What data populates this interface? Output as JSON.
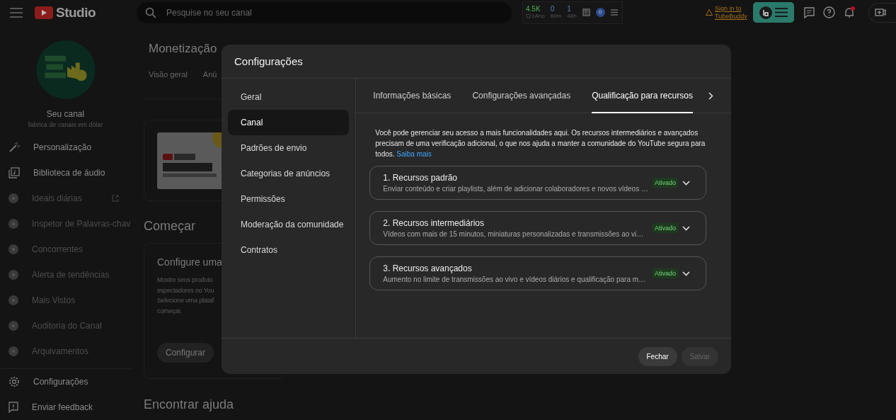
{
  "header": {
    "logo_text": "Studio",
    "search": {
      "placeholder": "Pesquise no seu canal"
    },
    "stats": [
      {
        "value": "4.5K",
        "label": "1Ano"
      },
      {
        "value": "0",
        "label": "60m"
      },
      {
        "value": "1",
        "label": "48h"
      }
    ],
    "signin_link": "Sign in to TubeBuddy"
  },
  "sidebar": {
    "channel_name": "Seu canal",
    "channel_handle": "fabrica de canais em dólar",
    "items": [
      {
        "label": "Personalização",
        "kind": "main",
        "external": false
      },
      {
        "label": "Biblioteca de áudio",
        "kind": "main",
        "external": false
      },
      {
        "label": "Ideais diárias",
        "kind": "addon",
        "external": true
      },
      {
        "label": "Inspetor de Palavras-chav",
        "kind": "addon",
        "external": false
      },
      {
        "label": "Concorrentes",
        "kind": "addon",
        "external": false
      },
      {
        "label": "Alerta de tendências",
        "kind": "addon",
        "external": false
      },
      {
        "label": "Mais Vistos",
        "kind": "addon",
        "external": false
      },
      {
        "label": "Auditoria do Canal",
        "kind": "addon",
        "external": false
      },
      {
        "label": "Arquivamentos",
        "kind": "addon",
        "external": false
      }
    ],
    "footer_items": [
      {
        "label": "Configurações"
      },
      {
        "label": "Enviar feedback"
      }
    ]
  },
  "page": {
    "title": "Monetização",
    "tabs": [
      {
        "label": "Visão geral",
        "selected": false
      },
      {
        "label": "Anú",
        "selected": false
      }
    ],
    "section_title": "Começar",
    "card": {
      "title": "Configure uma",
      "text": "Mostre seus produto\nespectadores no You\nSelecione uma plataf\ncomeçar.",
      "button": "Configurar"
    },
    "help_title": "Encontrar ajuda"
  },
  "dialog": {
    "title": "Configurações",
    "nav": [
      {
        "label": "Geral",
        "selected": false
      },
      {
        "label": "Canal",
        "selected": true
      },
      {
        "label": "Padrões de envio",
        "selected": false
      },
      {
        "label": "Categorias de anúncios",
        "selected": false
      },
      {
        "label": "Permissões",
        "selected": false
      },
      {
        "label": "Moderação da comunidade",
        "selected": false
      },
      {
        "label": "Contratos",
        "selected": false
      }
    ],
    "tabs": [
      {
        "label": "Informações básicas",
        "selected": false
      },
      {
        "label": "Configurações avançadas",
        "selected": false
      },
      {
        "label": "Qualificação para recursos",
        "selected": true
      }
    ],
    "intro": "Você pode gerenciar seu acesso a mais funcionalidades aqui. Os recursos intermediários e avançados precisam de uma verificação adicional, o que nos ajuda a manter a comunidade do YouTube segura para todos.",
    "intro_link": "Saiba mais",
    "features": [
      {
        "title": "1. Recursos padrão",
        "description": "Enviar conteúdo e criar playlists, além de adicionar colaboradores e novos vídeos …",
        "status": "Ativado",
        "expanded": false
      },
      {
        "title": "2. Recursos intermediários",
        "description": "Vídeos com mais de 15 minutos, miniaturas personalizadas e transmissões ao vi…",
        "status": "Ativado",
        "expanded": false
      },
      {
        "title": "3. Recursos avançados",
        "description": "Aumento no limite de transmissões ao vivo e vídeos diários e qualificação para m…",
        "status": "Ativado",
        "expanded": false
      }
    ],
    "buttons": [
      {
        "label": "Fechar",
        "disabled": false
      },
      {
        "label": "Salvar",
        "disabled": true
      }
    ]
  }
}
